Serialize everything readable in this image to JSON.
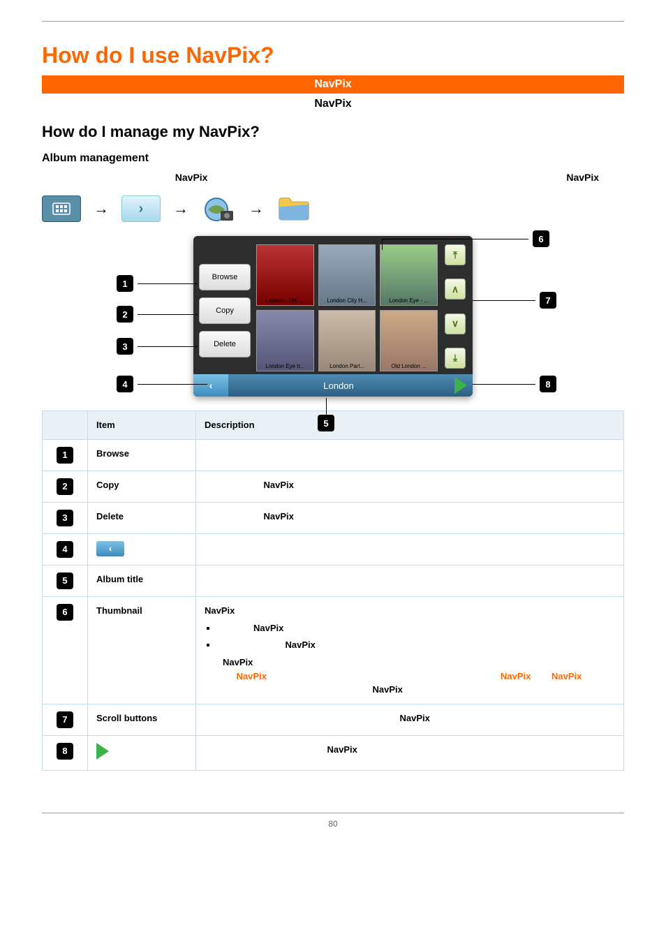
{
  "page_number": "80",
  "title_pre": "How do I use ",
  "title_brand": "NavPix",
  "title_post": "?",
  "bar_brand": "NavPix",
  "subbar_brand": "NavPix",
  "h2_pre": "How do I manage my ",
  "h2_brand": "NavPix",
  "h2_post": "?",
  "h3": "Album management",
  "intro_brand1": "NavPix",
  "intro_brand2": "NavPix",
  "shot": {
    "btn_browse": "Browse",
    "btn_copy": "Copy",
    "btn_delete": "Delete",
    "album_title": "London",
    "thumbs": [
      "London - UK: ...",
      "London City H...",
      "London Eye - ...",
      "London Eye tr...",
      "London Parl...",
      "Old London ..."
    ]
  },
  "callouts": [
    "1",
    "2",
    "3",
    "4",
    "5",
    "6",
    "7",
    "8"
  ],
  "table": {
    "head_item": "Item",
    "head_desc": "Description",
    "rows": [
      {
        "num": "1",
        "item": "Browse",
        "desc_html": "browse"
      },
      {
        "num": "2",
        "item": "Copy",
        "desc_html": "copy_navpix"
      },
      {
        "num": "3",
        "item": "Delete",
        "desc_html": "delete_navpix"
      },
      {
        "num": "4",
        "item": "back_icon",
        "desc_html": "back"
      },
      {
        "num": "5",
        "item": "Album title",
        "desc_html": "title"
      },
      {
        "num": "6",
        "item": "Thumbnail",
        "desc_html": "thumb"
      },
      {
        "num": "7",
        "item": "Scroll buttons",
        "desc_html": "scroll"
      },
      {
        "num": "8",
        "item": "go_icon",
        "desc_html": "go"
      }
    ]
  },
  "cell": {
    "copy_w": "NavPix",
    "delete_w": "NavPix",
    "thumb_w1": "NavPix",
    "thumb_w2": "NavPix",
    "thumb_w3": "NavPix",
    "thumb_w4": "NavPix",
    "thumb_w5": "NavPix",
    "thumb_link1": "NavPix",
    "thumb_link2": "NavPix",
    "thumb_link3": "NavPix",
    "scroll_w": "NavPix",
    "go_w": "NavPix"
  }
}
